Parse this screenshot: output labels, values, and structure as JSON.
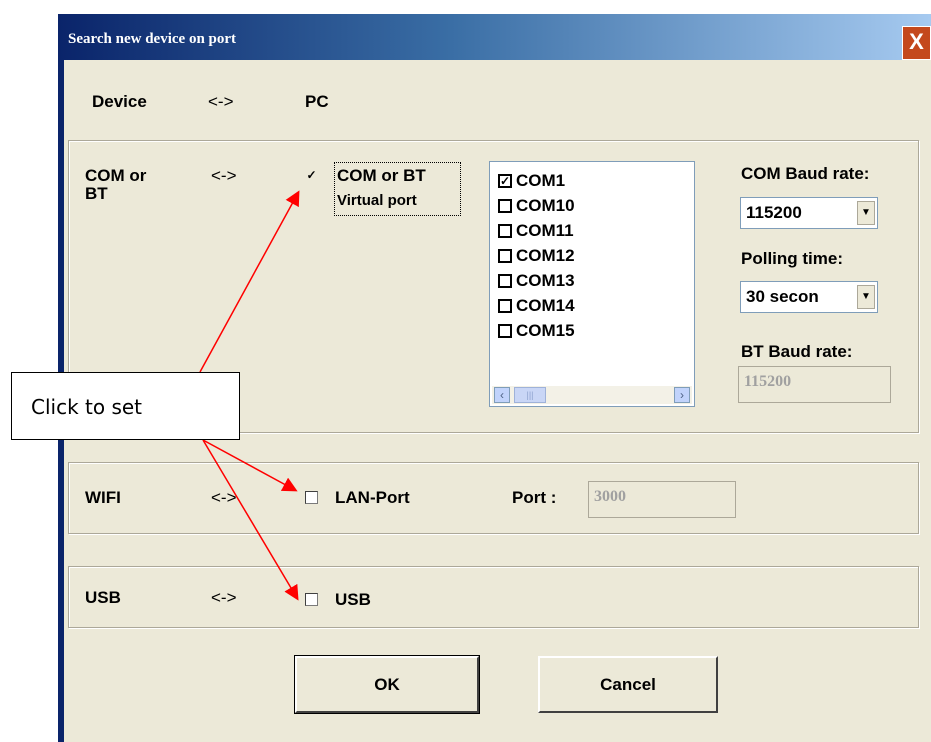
{
  "window": {
    "title": "Search new device on port",
    "close_glyph": "X"
  },
  "header": {
    "device": "Device",
    "arrow": "<->",
    "pc": "PC"
  },
  "com_group": {
    "label_line1": "COM or",
    "label_line2": "BT",
    "arrow": "<->",
    "virtual_port_line1": "COM or BT",
    "virtual_port_line2": "Virtual port",
    "virtual_port_checked": true,
    "ports": [
      {
        "name": "COM1",
        "checked": true
      },
      {
        "name": "COM10",
        "checked": false
      },
      {
        "name": "COM11",
        "checked": false
      },
      {
        "name": "COM12",
        "checked": false
      },
      {
        "name": "COM13",
        "checked": false
      },
      {
        "name": "COM14",
        "checked": false
      },
      {
        "name": "COM15",
        "checked": false
      }
    ],
    "baud_label": "COM Baud rate:",
    "baud_value": "115200",
    "polling_label": "Polling time:",
    "polling_value": "30 secon",
    "bt_baud_label": "BT Baud rate:",
    "bt_baud_value": "115200"
  },
  "wifi_group": {
    "label": "WIFI",
    "arrow": "<->",
    "lan_label": "LAN-Port",
    "lan_checked": false,
    "port_label": "Port :",
    "port_value": "3000"
  },
  "usb_group": {
    "label": "USB",
    "arrow": "<->",
    "usb_label": "USB",
    "usb_checked": false
  },
  "buttons": {
    "ok": "OK",
    "cancel": "Cancel"
  },
  "annotation": {
    "text": "Click to set",
    "arrow_color": "#ff0000"
  }
}
